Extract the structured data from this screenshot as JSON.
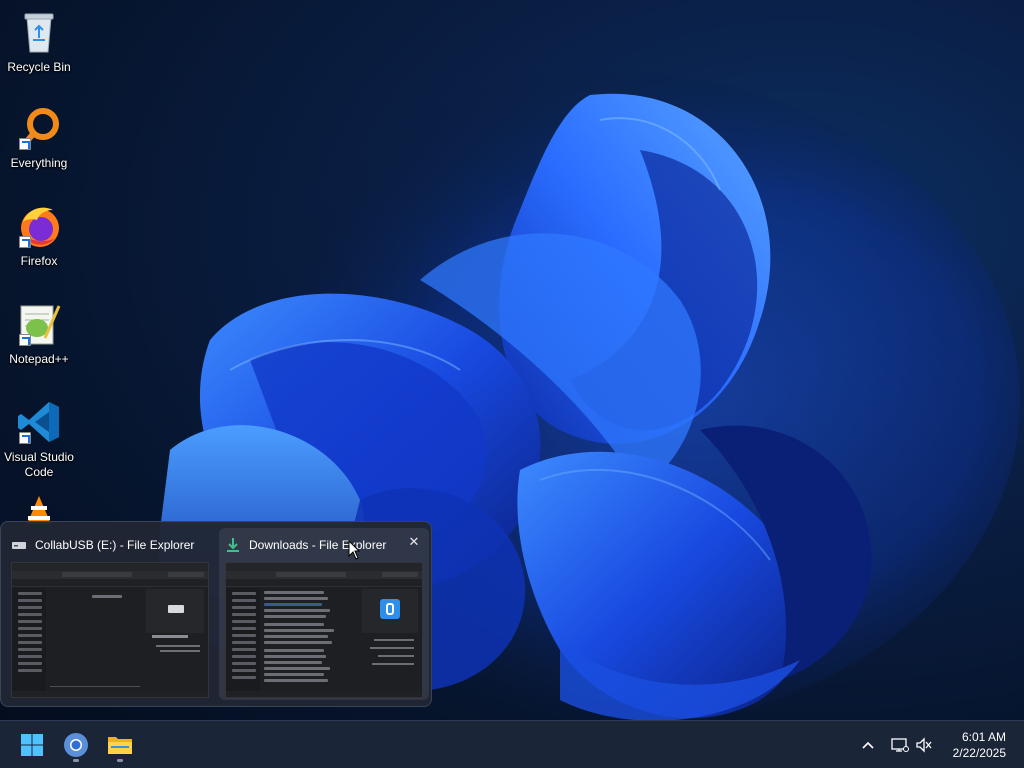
{
  "desktop": {
    "icons": [
      {
        "label": "Recycle Bin",
        "icon": "recycle-bin-icon"
      },
      {
        "label": "Everything",
        "icon": "everything-search-icon"
      },
      {
        "label": "Firefox",
        "icon": "firefox-icon"
      },
      {
        "label": "Notepad++",
        "icon": "notepad-plus-plus-icon"
      },
      {
        "label": "Visual Studio Code",
        "icon": "vscode-icon"
      },
      {
        "label": "",
        "icon": "vlc-icon"
      }
    ]
  },
  "taskbar_preview": {
    "windows": [
      {
        "title": "CollabUSB (E:) - File Explorer",
        "icon": "usb-drive-icon",
        "drive_caption": "Local disk"
      },
      {
        "title": "Downloads - File Explorer",
        "icon": "download-icon",
        "hovered": true
      }
    ],
    "close_label": "✕"
  },
  "taskbar": {
    "items": [
      {
        "name": "start",
        "icon": "windows-start-icon"
      },
      {
        "name": "chrome",
        "icon": "chrome-icon",
        "running": true
      },
      {
        "name": "file-explorer",
        "icon": "folder-icon",
        "running": true
      }
    ],
    "tray": {
      "overflow": "^",
      "network_icon": "network-icon",
      "volume_icon": "volume-muted-icon"
    },
    "clock": {
      "time": "6:01 AM",
      "date": "2/22/2025"
    }
  },
  "colors": {
    "accent": "#1f6fd6",
    "taskbar_bg": "#1b2538",
    "wallpaper_dark": "#06142c",
    "bloom": "#1c55e6"
  }
}
